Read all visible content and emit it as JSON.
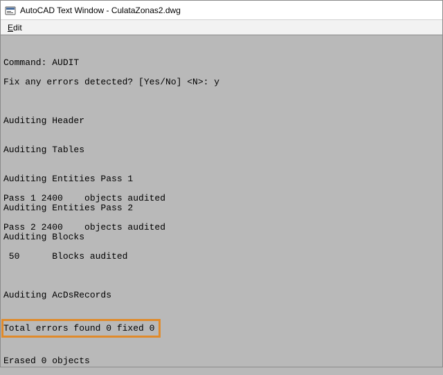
{
  "titlebar": {
    "icon_name": "autocad-command-icon",
    "title": "AutoCAD Text Window - CulataZonas2.dwg"
  },
  "menubar": {
    "items": [
      {
        "label_pre": "",
        "hotkey": "E",
        "label_post": "dit"
      }
    ]
  },
  "console": {
    "lines": [
      "",
      "Command: AUDIT",
      "",
      "Fix any errors detected? [Yes/No] <N>: y",
      "",
      "",
      "",
      "Auditing Header",
      "",
      "",
      "Auditing Tables",
      "",
      "",
      "Auditing Entities Pass 1",
      "",
      "Pass 1 2400    objects audited",
      "Auditing Entities Pass 2",
      "",
      "Pass 2 2400    objects audited",
      "Auditing Blocks",
      "",
      " 50      Blocks audited",
      "",
      "",
      "",
      "Auditing AcDsRecords",
      ""
    ],
    "highlighted_line": "Total errors found 0 fixed 0",
    "after_highlight_lines": [
      "",
      "Erased 0 objects"
    ]
  }
}
